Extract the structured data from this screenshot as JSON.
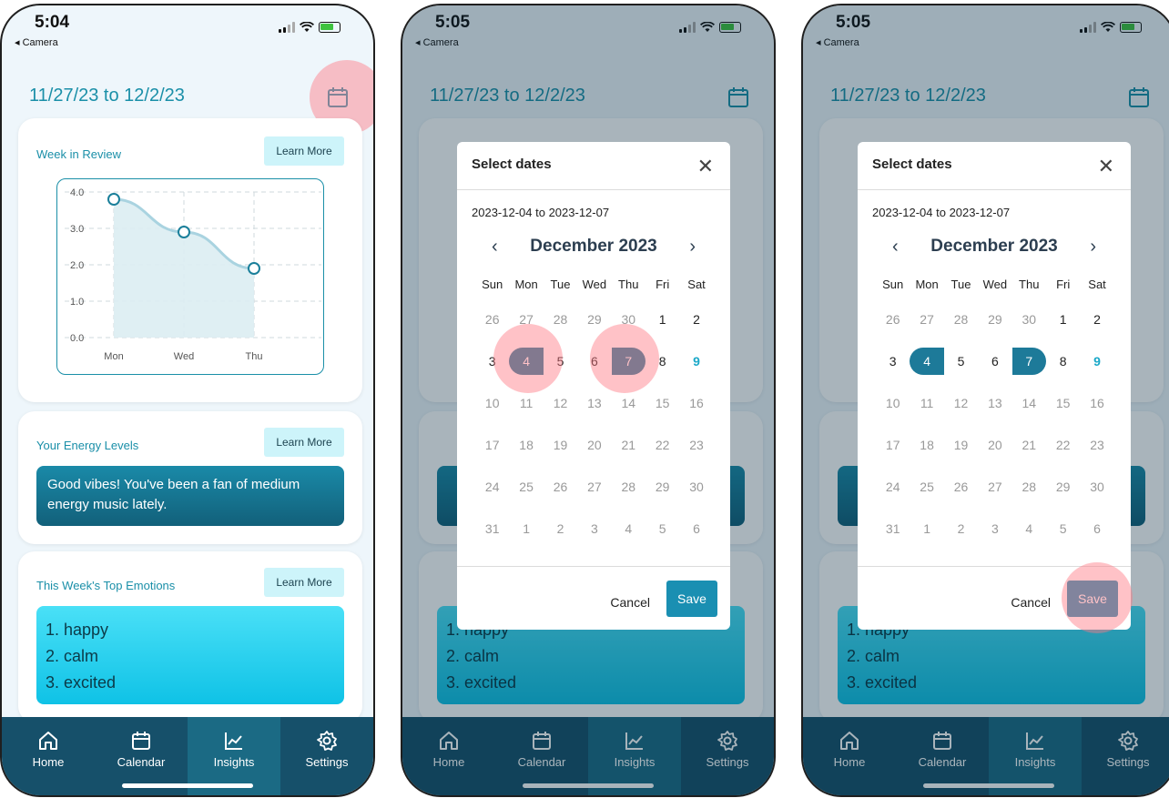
{
  "status": {
    "time_1": "5:04",
    "time_2": "5:05",
    "time_3": "5:05",
    "back_label": "◂ Camera"
  },
  "header": {
    "date_range": "11/27/23 to 12/2/23"
  },
  "cards": {
    "week_review": {
      "title": "Week in Review",
      "learn_more": "Learn More"
    },
    "energy": {
      "title": "Your Energy Levels",
      "learn_more": "Learn More",
      "message": "Good vibes! You've been a fan of medium energy music lately."
    },
    "emotions": {
      "title": "This Week's Top Emotions",
      "learn_more": "Learn More",
      "items": [
        "1. happy",
        "2. calm",
        "3. excited"
      ]
    }
  },
  "chart_data": {
    "type": "area",
    "categories": [
      "Mon",
      "Wed",
      "Thu"
    ],
    "values": [
      3.8,
      2.9,
      1.9
    ],
    "y_ticks": [
      "4.0",
      "3.0",
      "2.0",
      "1.0",
      "0.0"
    ],
    "ylim": [
      0,
      4
    ],
    "grid": true,
    "line_color": "#a9d3e0",
    "fill_color": "#dcedf2"
  },
  "tabbar": {
    "tabs": [
      {
        "label": "Home",
        "icon": "home-icon"
      },
      {
        "label": "Calendar",
        "icon": "calendar-icon"
      },
      {
        "label": "Insights",
        "icon": "chart-line-icon"
      },
      {
        "label": "Settings",
        "icon": "gear-icon"
      }
    ],
    "active": "Insights"
  },
  "modal": {
    "title": "Select dates",
    "close": "✕",
    "range_text": "2023-12-04 to 2023-12-07",
    "month": "December 2023",
    "prev": "‹",
    "next": "›",
    "weekdays": [
      "Sun",
      "Mon",
      "Tue",
      "Wed",
      "Thu",
      "Fri",
      "Sat"
    ],
    "weeks": [
      [
        "26",
        "27",
        "28",
        "29",
        "30",
        "1",
        "2"
      ],
      [
        "3",
        "4",
        "5",
        "6",
        "7",
        "8",
        "9"
      ],
      [
        "10",
        "11",
        "12",
        "13",
        "14",
        "15",
        "16"
      ],
      [
        "17",
        "18",
        "19",
        "20",
        "21",
        "22",
        "23"
      ],
      [
        "24",
        "25",
        "26",
        "27",
        "28",
        "29",
        "30"
      ],
      [
        "31",
        "1",
        "2",
        "3",
        "4",
        "5",
        "6"
      ]
    ],
    "selected_start": "4",
    "selected_end": "7",
    "today": "9",
    "cancel": "Cancel",
    "save": "Save"
  },
  "colors": {
    "accent": "#1a8fa8",
    "tabbar": "#16506a",
    "tab_active": "#1b6a84",
    "selected_day": "#1d7a99",
    "tap_highlight": "#ff7882"
  }
}
